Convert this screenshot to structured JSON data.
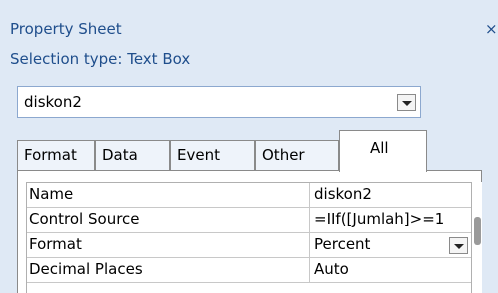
{
  "panel": {
    "title": "Property Sheet",
    "close_glyph": "×",
    "selection_type": "Selection type:  Text Box"
  },
  "object_selector": {
    "value": "diskon2",
    "dropdown_icon": "chevron-down-icon"
  },
  "tabs": [
    {
      "label": "Format",
      "active": false
    },
    {
      "label": "Data",
      "active": false
    },
    {
      "label": "Event",
      "active": false
    },
    {
      "label": "Other",
      "active": false
    },
    {
      "label": "All",
      "active": true
    }
  ],
  "properties": [
    {
      "name": "Name",
      "value": "diskon2"
    },
    {
      "name": "Control Source",
      "value": "=IIf([Jumlah]>=1"
    },
    {
      "name": "Format",
      "value": "Percent",
      "has_dropdown": true
    },
    {
      "name": "Decimal Places",
      "value": "Auto"
    }
  ],
  "colors": {
    "pane_background": "#dfe9f5",
    "title_text": "#1f4e8c",
    "grid_background": "#ffffff"
  }
}
